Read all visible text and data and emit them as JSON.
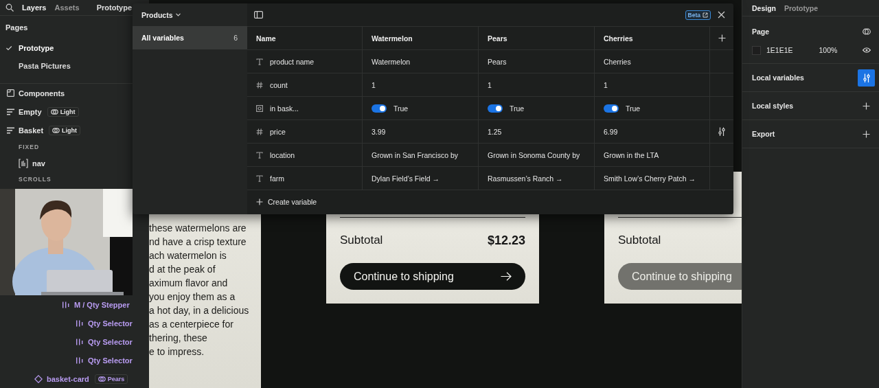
{
  "layers_panel": {
    "tabs": [
      {
        "label": "Layers",
        "selected": true
      },
      {
        "label": "Assets",
        "selected": false
      }
    ],
    "page_menu": "Prototype",
    "pages_title": "Pages",
    "pages": [
      {
        "label": "Prototype",
        "selected": true
      },
      {
        "label": "Pasta Pictures",
        "selected": false
      }
    ],
    "layers": [
      {
        "kind": "section",
        "label": "Components"
      },
      {
        "kind": "frame",
        "label": "Empty",
        "badge": "Light"
      },
      {
        "kind": "frame",
        "label": "Basket",
        "badge": "Light",
        "children": [
          {
            "kind": "heading",
            "label": "FIXED"
          },
          {
            "kind": "instance",
            "label": "nav"
          },
          {
            "kind": "heading",
            "label": "SCROLLS"
          }
        ]
      }
    ],
    "lower_layers": [
      {
        "kind": "component-set",
        "label": "M / Qty Stepper",
        "children": [
          {
            "kind": "component-set",
            "label": "Qty Selector"
          },
          {
            "kind": "component-set",
            "label": "Qty Selector"
          },
          {
            "kind": "component-set",
            "label": "Qty Selector"
          }
        ]
      },
      {
        "kind": "component",
        "label": "basket-card",
        "badge": "Pears"
      }
    ]
  },
  "variables_modal": {
    "collection": "Products",
    "groups": [
      {
        "label": "All variables",
        "count": "6",
        "selected": true
      }
    ],
    "beta": "Beta",
    "columns": [
      "Name",
      "Watermelon",
      "Pears",
      "Cherries"
    ],
    "rows": [
      {
        "kind": "string",
        "name": "product name",
        "hovered": false,
        "values": [
          "Watermelon",
          "Pears",
          "Cherries"
        ]
      },
      {
        "kind": "number",
        "name": "count",
        "hovered": false,
        "values": [
          "1",
          "1",
          "1"
        ]
      },
      {
        "kind": "boolean",
        "name": "in bask...",
        "hovered": false,
        "values": [
          {
            "on": true,
            "text": "True"
          },
          {
            "on": true,
            "text": "True"
          },
          {
            "on": true,
            "text": "True"
          }
        ]
      },
      {
        "kind": "number",
        "name": "price",
        "hovered": true,
        "values": [
          "3.99",
          "1.25",
          "6.99"
        ]
      },
      {
        "kind": "string",
        "name": "location",
        "hovered": false,
        "values": [
          "Grown in San Francisco by",
          "Grown in Sonoma County by",
          "Grown in the LTA"
        ]
      },
      {
        "kind": "string",
        "name": "farm",
        "hovered": false,
        "values": [
          "Dylan Field’s Field →",
          "Rasmussen’s Ranch →",
          "Smith Low’s Cherry Patch →"
        ]
      }
    ],
    "create": "Create variable"
  },
  "canvas": {
    "description_card": {
      "text": "these watermelons are\nnd have a crisp texture\nach watermelon is\nd at the peak of\naximum flavor and\nyou enjoy them as a\na hot day, in a delicious\nas a centerpiece for\nthering, these\ne to impress."
    },
    "basket_cards": [
      {
        "subtotal_label": "Subtotal",
        "subtotal": "$12.23",
        "button": "Continue to shipping",
        "enabled": true
      },
      {
        "subtotal_label": "Subtotal",
        "button": "Continue to shipping",
        "enabled": false
      }
    ]
  },
  "design_panel": {
    "tabs": [
      {
        "label": "Design",
        "selected": true
      },
      {
        "label": "Prototype",
        "selected": false
      }
    ],
    "page_title": "Page",
    "page_color": "1E1E1E",
    "opacity": "100%",
    "sections": [
      {
        "kind": "variables",
        "label": "Local variables",
        "active": true
      },
      {
        "kind": "add",
        "label": "Local styles",
        "active": false
      },
      {
        "kind": "add",
        "label": "Export",
        "active": false
      }
    ]
  }
}
